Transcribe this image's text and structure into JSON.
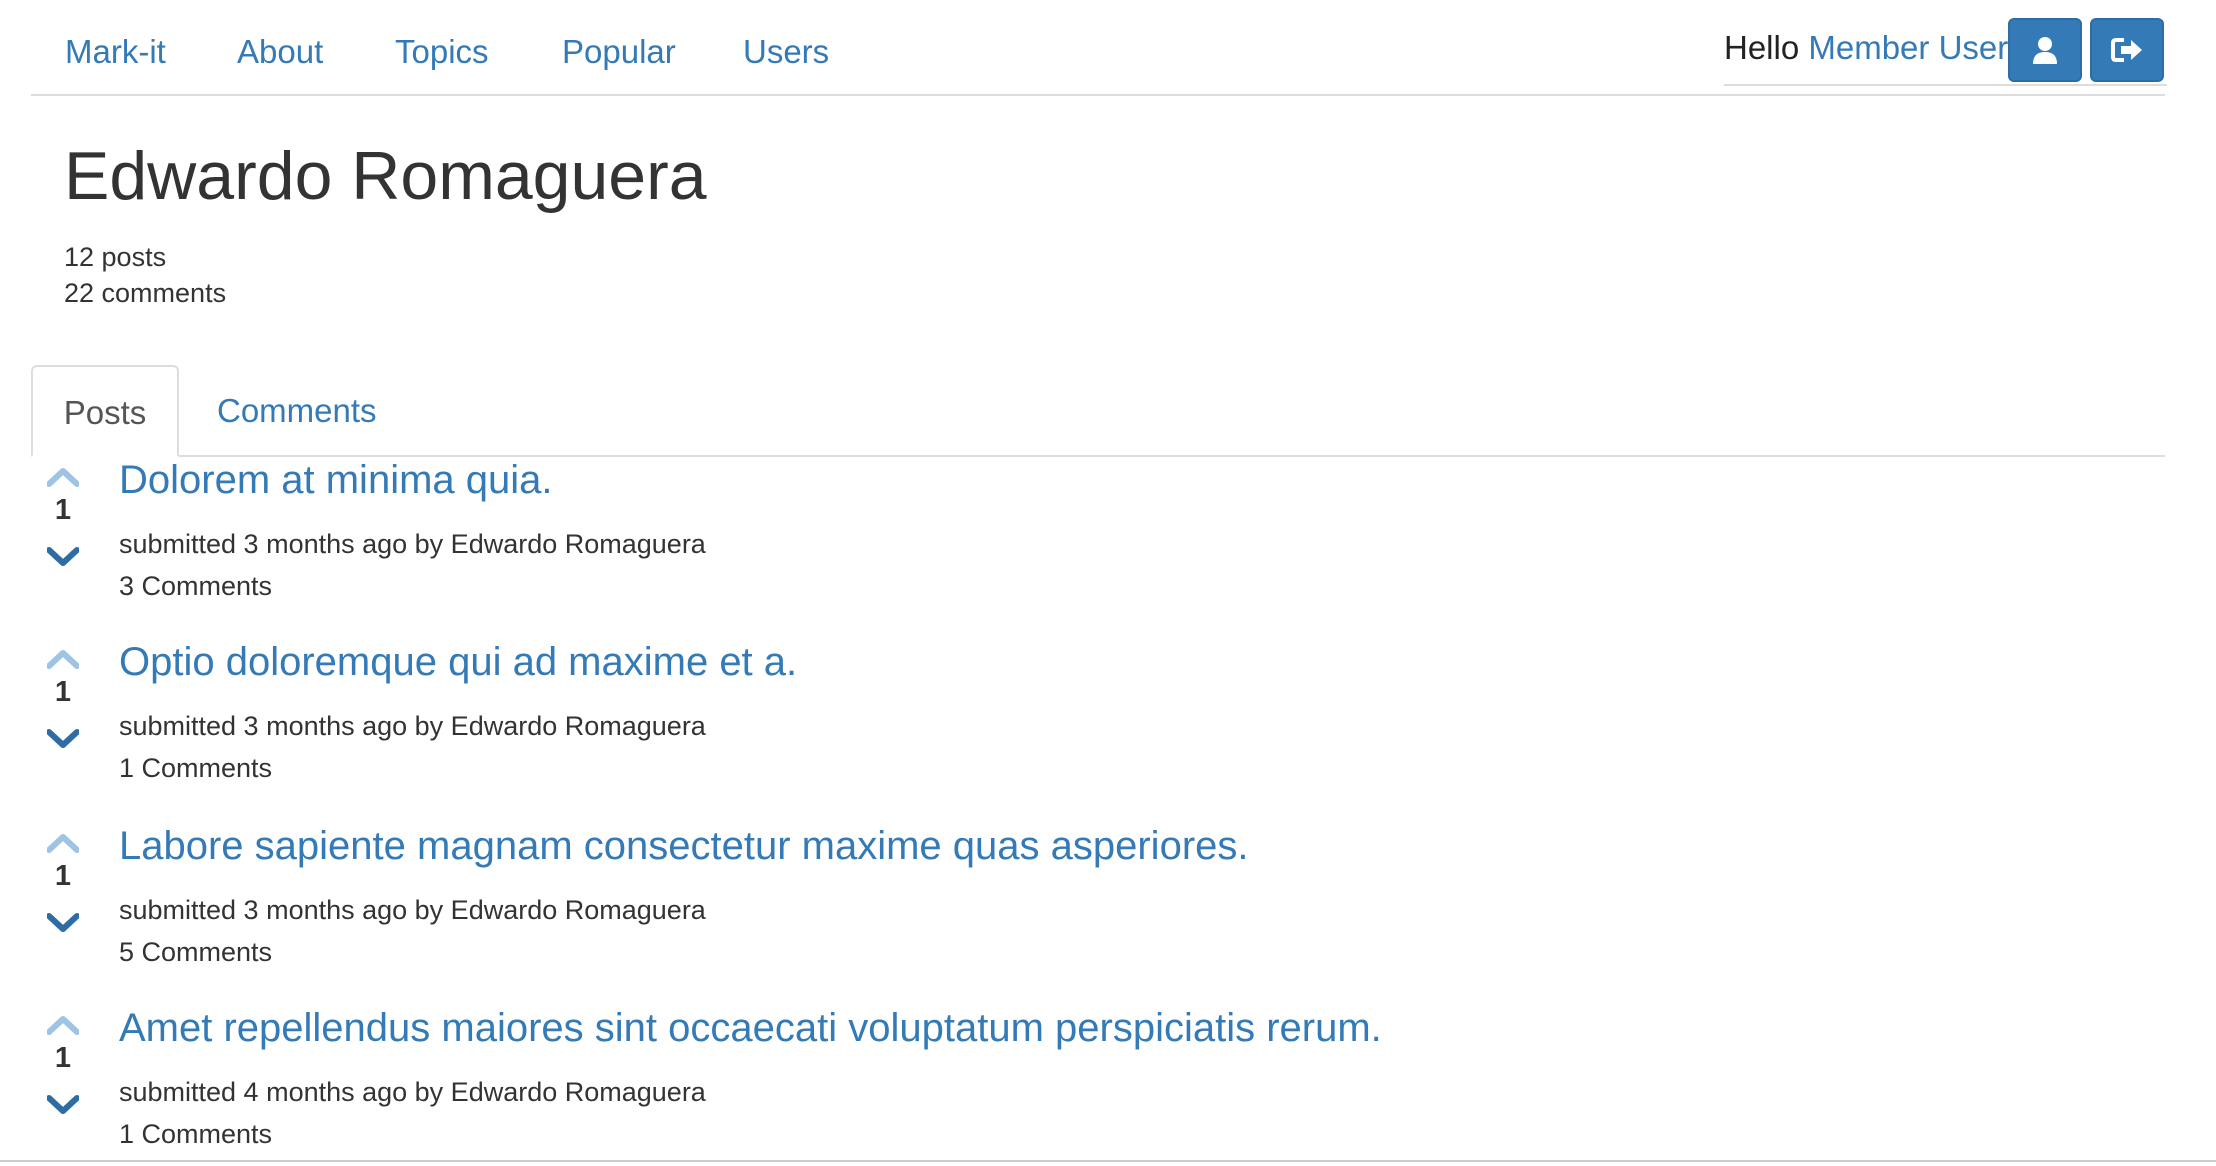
{
  "nav": {
    "brand": "Mark-it",
    "links": [
      "About",
      "Topics",
      "Popular",
      "Users"
    ]
  },
  "user_area": {
    "greeting": "Hello ",
    "user_name": "Member User",
    "exclaim": "!",
    "profile_icon": "user-icon",
    "logout_icon": "sign-out-icon"
  },
  "profile": {
    "name": "Edwardo Romaguera",
    "posts_count": "12 posts",
    "comments_count": "22 comments"
  },
  "tabs": {
    "posts": "Posts",
    "comments": "Comments"
  },
  "posts": [
    {
      "votes": "1",
      "title": "Dolorem at minima quia.",
      "meta": "submitted 3 months ago by Edwardo Romaguera",
      "comments": "3 Comments"
    },
    {
      "votes": "1",
      "title": "Optio doloremque qui ad maxime et a.",
      "meta": "submitted 3 months ago by Edwardo Romaguera",
      "comments": "1 Comments"
    },
    {
      "votes": "1",
      "title": "Labore sapiente magnam consectetur maxime quas asperiores.",
      "meta": "submitted 3 months ago by Edwardo Romaguera",
      "comments": "5 Comments"
    },
    {
      "votes": "1",
      "title": "Amet repellendus maiores sint occaecati voluptatum perspiciatis rerum.",
      "meta": "submitted 4 months ago by Edwardo Romaguera",
      "comments": "1 Comments"
    }
  ],
  "colors": {
    "link": "#337ab7",
    "upvote": "#9fc3e3",
    "downvote": "#2e6da4",
    "button": "#337ab7",
    "border": "#dddddd"
  }
}
